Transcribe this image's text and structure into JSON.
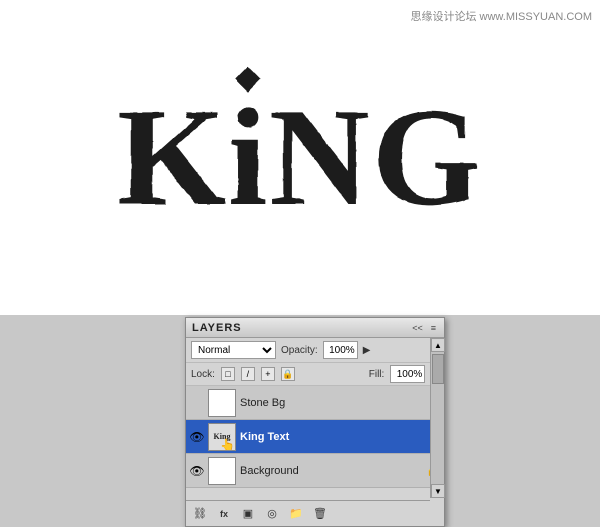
{
  "watermark": "思缘设计论坛 www.MISSYUAN.COM",
  "canvas": {
    "king_text": "KiNG",
    "king_text_full": "KING"
  },
  "layers_panel": {
    "title": "LAYERS",
    "collapse_btn": "<<",
    "menu_btn": "≡",
    "blend_label": "Normal",
    "opacity_label": "Opacity:",
    "opacity_value": "100%",
    "opacity_arrow": "▶",
    "lock_label": "Lock:",
    "fill_label": "Fill:",
    "fill_value": "100%",
    "fill_arrow": "▶",
    "lock_icons": [
      "□",
      "/",
      "+",
      "🔒"
    ],
    "layers": [
      {
        "name": "Stone Bg",
        "visible": false,
        "active": false,
        "locked": false,
        "thumb_type": "white"
      },
      {
        "name": "King Text",
        "visible": true,
        "active": true,
        "locked": false,
        "thumb_type": "king"
      },
      {
        "name": "Background",
        "visible": true,
        "active": false,
        "locked": true,
        "thumb_type": "white"
      }
    ],
    "toolbar_buttons": [
      "⛓",
      "fx",
      "▣",
      "◎",
      "📁",
      "🗑"
    ]
  }
}
